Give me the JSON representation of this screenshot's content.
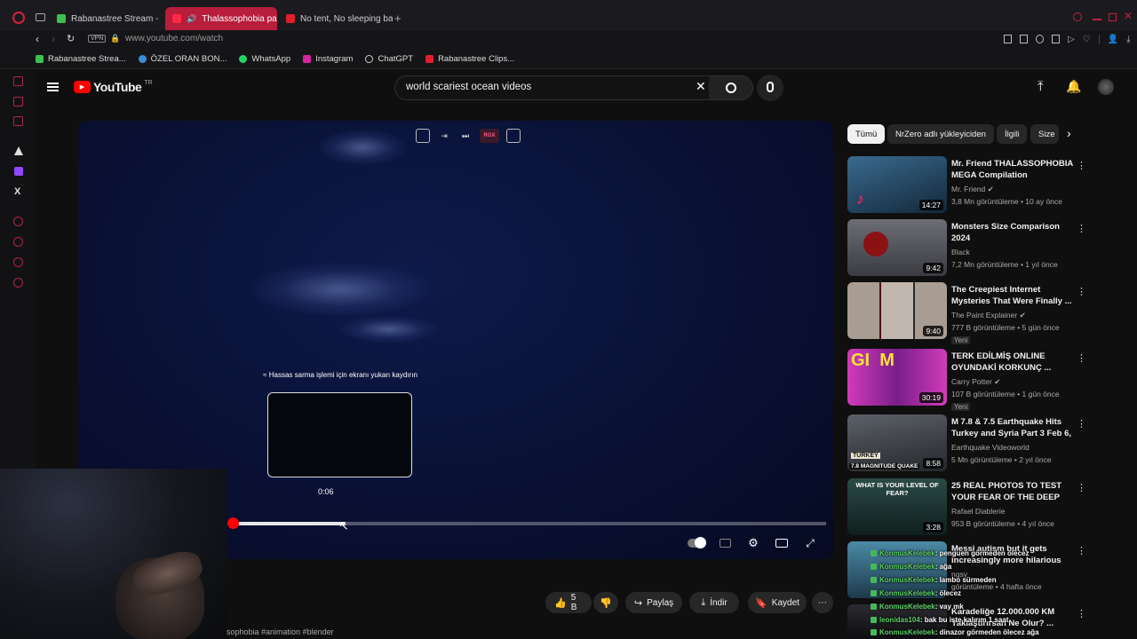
{
  "browser": {
    "tabs": [
      {
        "label": "Rabanastree Stream - Wa",
        "color": "#3fbf4f",
        "active": false
      },
      {
        "label": "Thalassophobia part",
        "color": "#ffffff",
        "active": true
      },
      {
        "label": "No tent, No sleeping bag",
        "color": "#e01e2e",
        "active": false
      }
    ],
    "url": "www.youtube.com/watch",
    "vpn_label": "VPN",
    "bookmarks": [
      {
        "label": "Rabanastree Strea...",
        "color": "#3fbf4f"
      },
      {
        "label": "ÖZEL ORAN BON...",
        "color": "#3a8fd6"
      },
      {
        "label": "WhatsApp",
        "color": "#25d366"
      },
      {
        "label": "Instagram",
        "color": "#d6249f"
      },
      {
        "label": "ChatGPT",
        "color": "#cccccc"
      },
      {
        "label": "Rabanastree Clips...",
        "color": "#e01e2e"
      }
    ]
  },
  "youtube": {
    "logo_text": "YouTube",
    "region": "TR",
    "search_value": "world scariest ocean videos"
  },
  "player": {
    "scrub_hint": "≈ Hassas sarma işlemi için ekranı yukarı kaydırın",
    "preview_time": "0:06",
    "progress_played_fraction": 0.0,
    "hover_fraction": 0.19,
    "top_overlay_badge": "RGX"
  },
  "actions": {
    "like_count": "5 B",
    "share": "Paylaş",
    "download": "İndir",
    "save": "Kaydet"
  },
  "description_fragment": "sophobia #animation #blender",
  "chips": [
    {
      "label": "Tümü",
      "selected": true
    },
    {
      "label": "NrZero adlı yükleyiciden",
      "selected": false
    },
    {
      "label": "İlgili",
      "selected": false
    },
    {
      "label": "Size",
      "selected": false
    }
  ],
  "recommendations": [
    {
      "title": "Mr. Friend THALASSOPHOBIA MEGA Compilation",
      "channel": "Mr. Friend",
      "verified": true,
      "meta": "3,8 Mn görüntüleme • 10 ay önce",
      "duration": "14:27",
      "badge": "",
      "thumb": "#2d4f6e"
    },
    {
      "title": "Monsters Size Comparison 2024",
      "channel": "Black",
      "verified": false,
      "meta": "7,2 Mn görüntüleme • 1 yıl önce",
      "duration": "9:42",
      "badge": "",
      "thumb": "#5a5a62"
    },
    {
      "title": "The Creepiest Internet Mysteries That Were Finally ...",
      "channel": "The Paint Explainer",
      "verified": true,
      "meta": "777 B görüntüleme • 5 gün önce",
      "duration": "9:40",
      "badge": "Yeni",
      "thumb": "#9a8f86"
    },
    {
      "title": "TERK EDİLMİŞ ONLINE OYUNDAKİ KORKUNÇ ...",
      "channel": "Carry Potter",
      "verified": true,
      "meta": "107 B görüntüleme • 1 gün önce",
      "duration": "30:19",
      "badge": "Yeni",
      "thumb": "#b93aa8"
    },
    {
      "title": "M 7.8 & 7.5 Earthquake Hits Turkey and Syria Part 3 Feb 6, ...",
      "channel": "Earthquake Videoworld",
      "verified": false,
      "meta": "5 Mn görüntüleme • 2 yıl önce",
      "duration": "8:58",
      "badge": "",
      "thumb": "#3b3f44"
    },
    {
      "title": "25 REAL PHOTOS TO TEST YOUR FEAR OF THE DEEP SEA...",
      "channel": "Rafael Diablerie",
      "verified": false,
      "meta": "953 B görüntüleme • 4 yıl önce",
      "duration": "3:28",
      "badge": "",
      "thumb": "#1f3b36"
    },
    {
      "title": "Messi autism but it gets increasingly more hilarious",
      "channel": "ngsy",
      "verified": false,
      "meta": "görüntüleme • 4 hafta önce",
      "duration": "",
      "badge": "",
      "thumb": "#3a6f86"
    },
    {
      "title": "Karadeliğe 12.000.000 KM Yaklaştırırsan Ne Olur? ...",
      "channel": "",
      "verified": false,
      "meta": "",
      "duration": "",
      "badge": "",
      "thumb": "#2a2a30"
    }
  ],
  "thumb_texts": {
    "turkey": "TURKEY",
    "magnitude": "7.8 MAGNITUDE QUAKE",
    "fear": "WHAT IS YOUR LEVEL OF FEAR?",
    "gm": "GI  M"
  },
  "chat": [
    {
      "user": "KonmusKelebek",
      "msg": ": penguen görmeden ölecez"
    },
    {
      "user": "KonmusKelebek",
      "msg": ": ağa"
    },
    {
      "user": "KonmusKelebek",
      "msg": ": lambo sürmeden"
    },
    {
      "user": "KonmusKelebek",
      "msg": ": ölecez"
    },
    {
      "user": "KonmusKelebek",
      "msg": ": vay mk"
    },
    {
      "user": "leonidas104",
      "msg": ": bak bu iste kalırım 1 saat"
    },
    {
      "user": "KonmusKelebek",
      "msg": ": dinazor görmeden ölecez ağa"
    }
  ]
}
